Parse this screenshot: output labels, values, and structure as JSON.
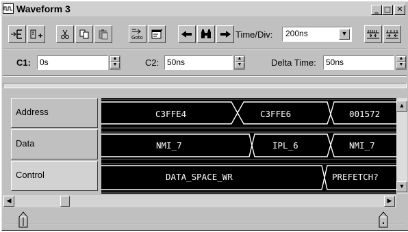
{
  "window": {
    "title": "Waveform 3"
  },
  "title_buttons": {
    "minimize": "_",
    "maximize": "□",
    "close": "✕"
  },
  "toolbar": {
    "time_div_label": "Time/Div:",
    "time_div_value": "200ns",
    "icons": [
      "insert-signal-icon",
      "add-signal-icon",
      "cut-icon",
      "copy-icon",
      "paste-icon",
      "goto-icon",
      "properties-icon",
      "arrow-left-icon",
      "binoculars-icon",
      "arrow-right-icon",
      "zoom-in-icon",
      "zoom-out-icon"
    ]
  },
  "cursors": {
    "c1_label": "C1:",
    "c1_value": "0s",
    "c2_label": "C2:",
    "c2_value": "50ns",
    "delta_label": "Delta Time:",
    "delta_value": "50ns"
  },
  "signals": [
    {
      "name": "Address",
      "values": [
        "C3FFE4",
        "C3FFE6",
        "001572"
      ]
    },
    {
      "name": "Data",
      "values": [
        "NMI_7",
        "IPL_6",
        "NMI_7"
      ]
    },
    {
      "name": "Control",
      "values": [
        "DATA_SPACE_WR",
        "PREFETCH?"
      ]
    }
  ],
  "scroll_glyphs": {
    "up": "▲",
    "down": "▼",
    "left": "◀",
    "right": "▶"
  }
}
